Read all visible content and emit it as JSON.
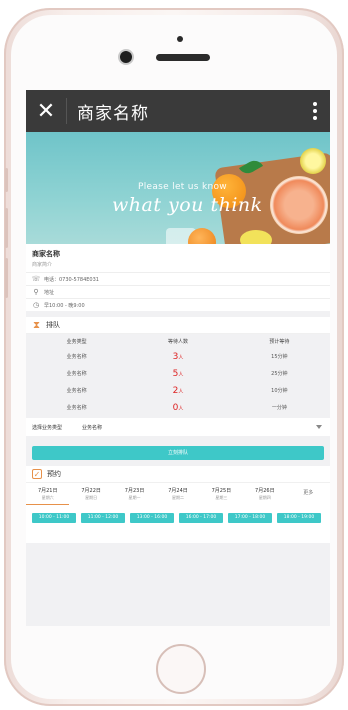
{
  "app": {
    "title": "商家名称"
  },
  "banner": {
    "small_text": "Please let us know",
    "large_text": "what you think"
  },
  "shop": {
    "name": "商家名称",
    "intro": "商家简介",
    "phone": "电话：0730-5784E031",
    "address": "地址",
    "hours": "早10:00 - 晚9:00"
  },
  "queue": {
    "section_label": "排队",
    "columns": [
      "业务类型",
      "等待人数",
      "预计等待"
    ],
    "unit": "人",
    "rows": [
      {
        "type": "业务名称",
        "count": "3",
        "wait": "15分钟"
      },
      {
        "type": "业务名称",
        "count": "5",
        "wait": "25分钟"
      },
      {
        "type": "业务名称",
        "count": "2",
        "wait": "10分钟"
      },
      {
        "type": "业务名称",
        "count": "0",
        "wait": "一分钟"
      }
    ],
    "select_label": "选择业务类型",
    "select_value": "业务名称",
    "button_label": "立刻排队"
  },
  "booking": {
    "section_label": "预约",
    "days": [
      {
        "date": "7月21日",
        "weekday": "星期六"
      },
      {
        "date": "7月22日",
        "weekday": "星期日"
      },
      {
        "date": "7月23日",
        "weekday": "星期一"
      },
      {
        "date": "7月24日",
        "weekday": "星期二"
      },
      {
        "date": "7月25日",
        "weekday": "星期三"
      },
      {
        "date": "7月26日",
        "weekday": "星期四"
      }
    ],
    "more_label": "更多",
    "slots": [
      "10:00 - 11:00",
      "11:00 - 12:00",
      "13:00 - 16:00",
      "16:00 - 17:00",
      "17:00 - 18:00",
      "18:00 - 19:00"
    ]
  },
  "colors": {
    "accent_teal": "#3ec8c8",
    "accent_orange": "#e7914a",
    "count_red": "#dd2222",
    "topbar": "#3a3a3a"
  },
  "icons": [
    "close-icon",
    "more-icon",
    "phone-icon",
    "location-icon",
    "clock-icon",
    "hourglass-icon",
    "check-icon",
    "caret-down-icon"
  ]
}
